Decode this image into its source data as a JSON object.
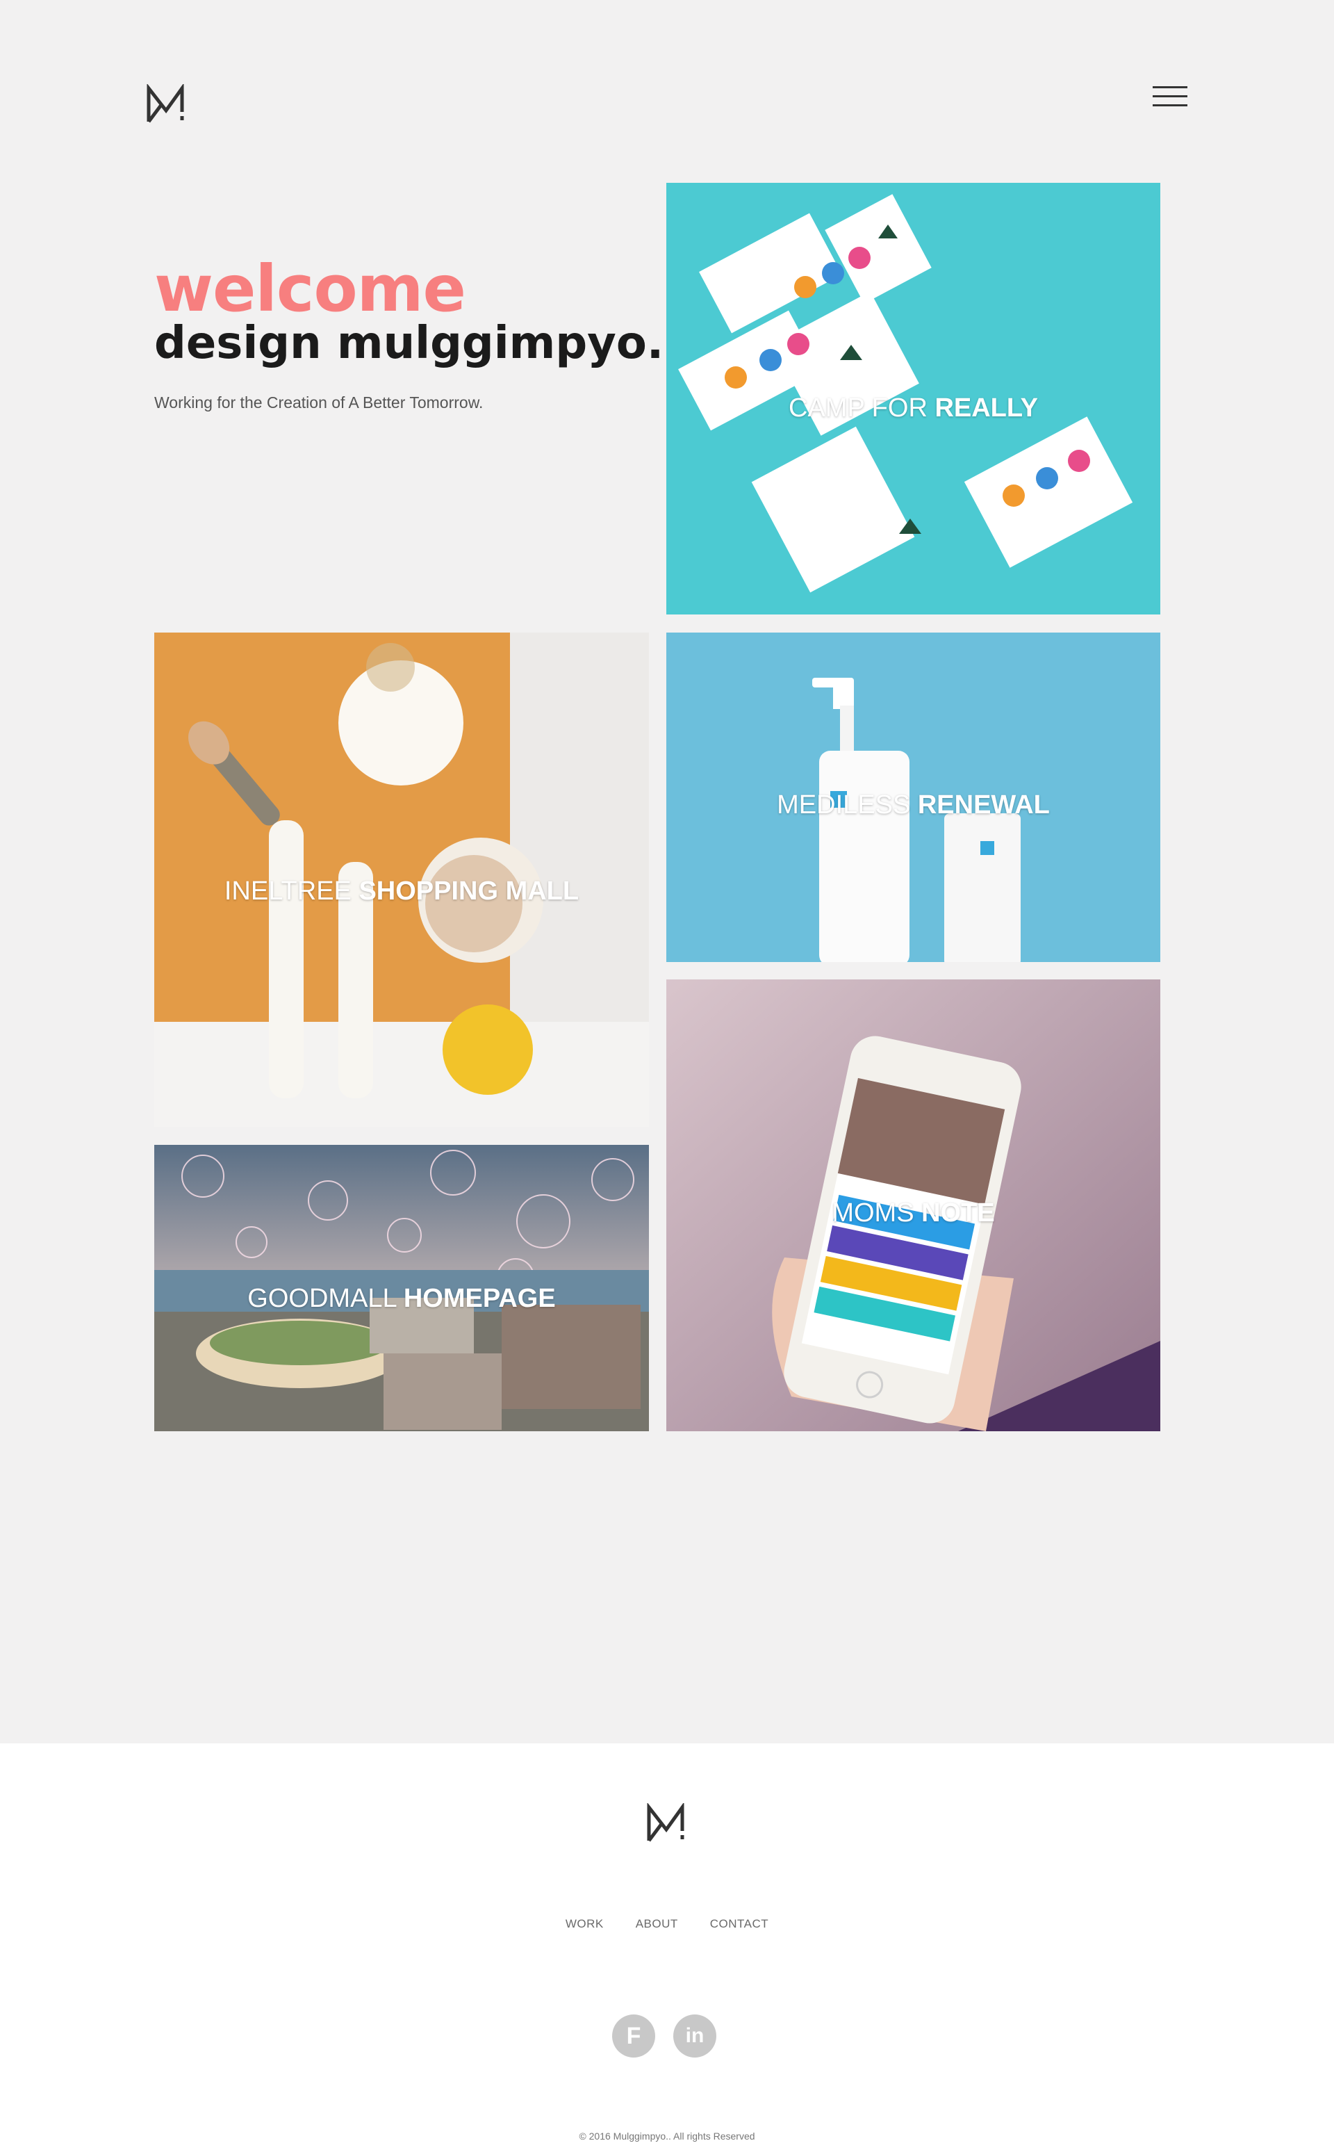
{
  "header": {
    "logo_icon": "mulggimpyo-logo-icon",
    "menu_icon": "hamburger-menu-icon"
  },
  "hero": {
    "welcome": "welcome",
    "title": "design mulggimpyo.",
    "subtitle": "Working for the Creation of A Better Tomorrow."
  },
  "portfolio": [
    {
      "light": "CAMP FOR ",
      "bold": "REALLY"
    },
    {
      "light": "INELTREE ",
      "bold": "SHOPPING MALL"
    },
    {
      "light": "MEDILESS ",
      "bold": "RENEWAL"
    },
    {
      "light": "MOMS ",
      "bold": "NOTE"
    },
    {
      "light": "GOODMALL ",
      "bold": "HOMEPAGE"
    }
  ],
  "footer": {
    "nav": [
      "WORK",
      "ABOUT",
      "CONTACT"
    ],
    "social": [
      {
        "icon": "facebook-icon",
        "label": "F"
      },
      {
        "icon": "linkedin-icon",
        "label": "in"
      }
    ],
    "copyright": "© 2016 Mulggimpyo.. All rights Reserved"
  },
  "colors": {
    "background": "#f2f1f1",
    "welcome_accent": "#f77f7f",
    "footer_bg": "#ffffff",
    "social_circle": "#c8c8c8"
  }
}
